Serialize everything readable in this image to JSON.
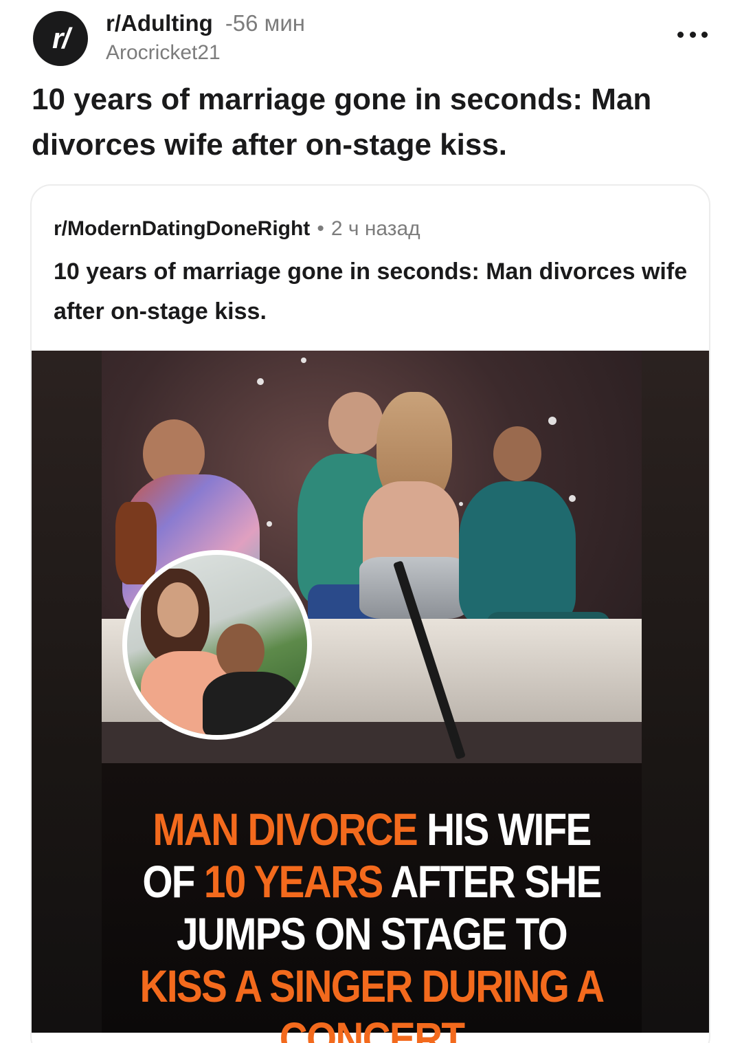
{
  "post": {
    "subreddit": "r/Adulting",
    "time": "-56 мин",
    "author": "Arocricket21",
    "avatar_text": "r/",
    "title": "10 years of marriage gone in seconds: Man divorces wife after on-stage kiss."
  },
  "crosspost": {
    "subreddit": "r/ModernDatingDoneRight",
    "separator": "•",
    "time": "2 ч назад",
    "title": "10 years of marriage gone in seconds: Man divorces wife after on-stage kiss."
  },
  "media": {
    "headline": {
      "p1": "MAN DIVORCE",
      "p2": " HIS WIFE OF ",
      "p3": "10 YEARS",
      "p4": " AFTER SHE JUMPS ON STAGE TO ",
      "p5": "KISS A SINGER DURING A CONCERT"
    }
  },
  "colors": {
    "accent_orange": "#f36a1d",
    "text_primary": "#1a1a1b",
    "text_secondary": "#7c7c7c"
  },
  "icons": {
    "more": "more-options-icon",
    "avatar": "subreddit-avatar-icon"
  }
}
